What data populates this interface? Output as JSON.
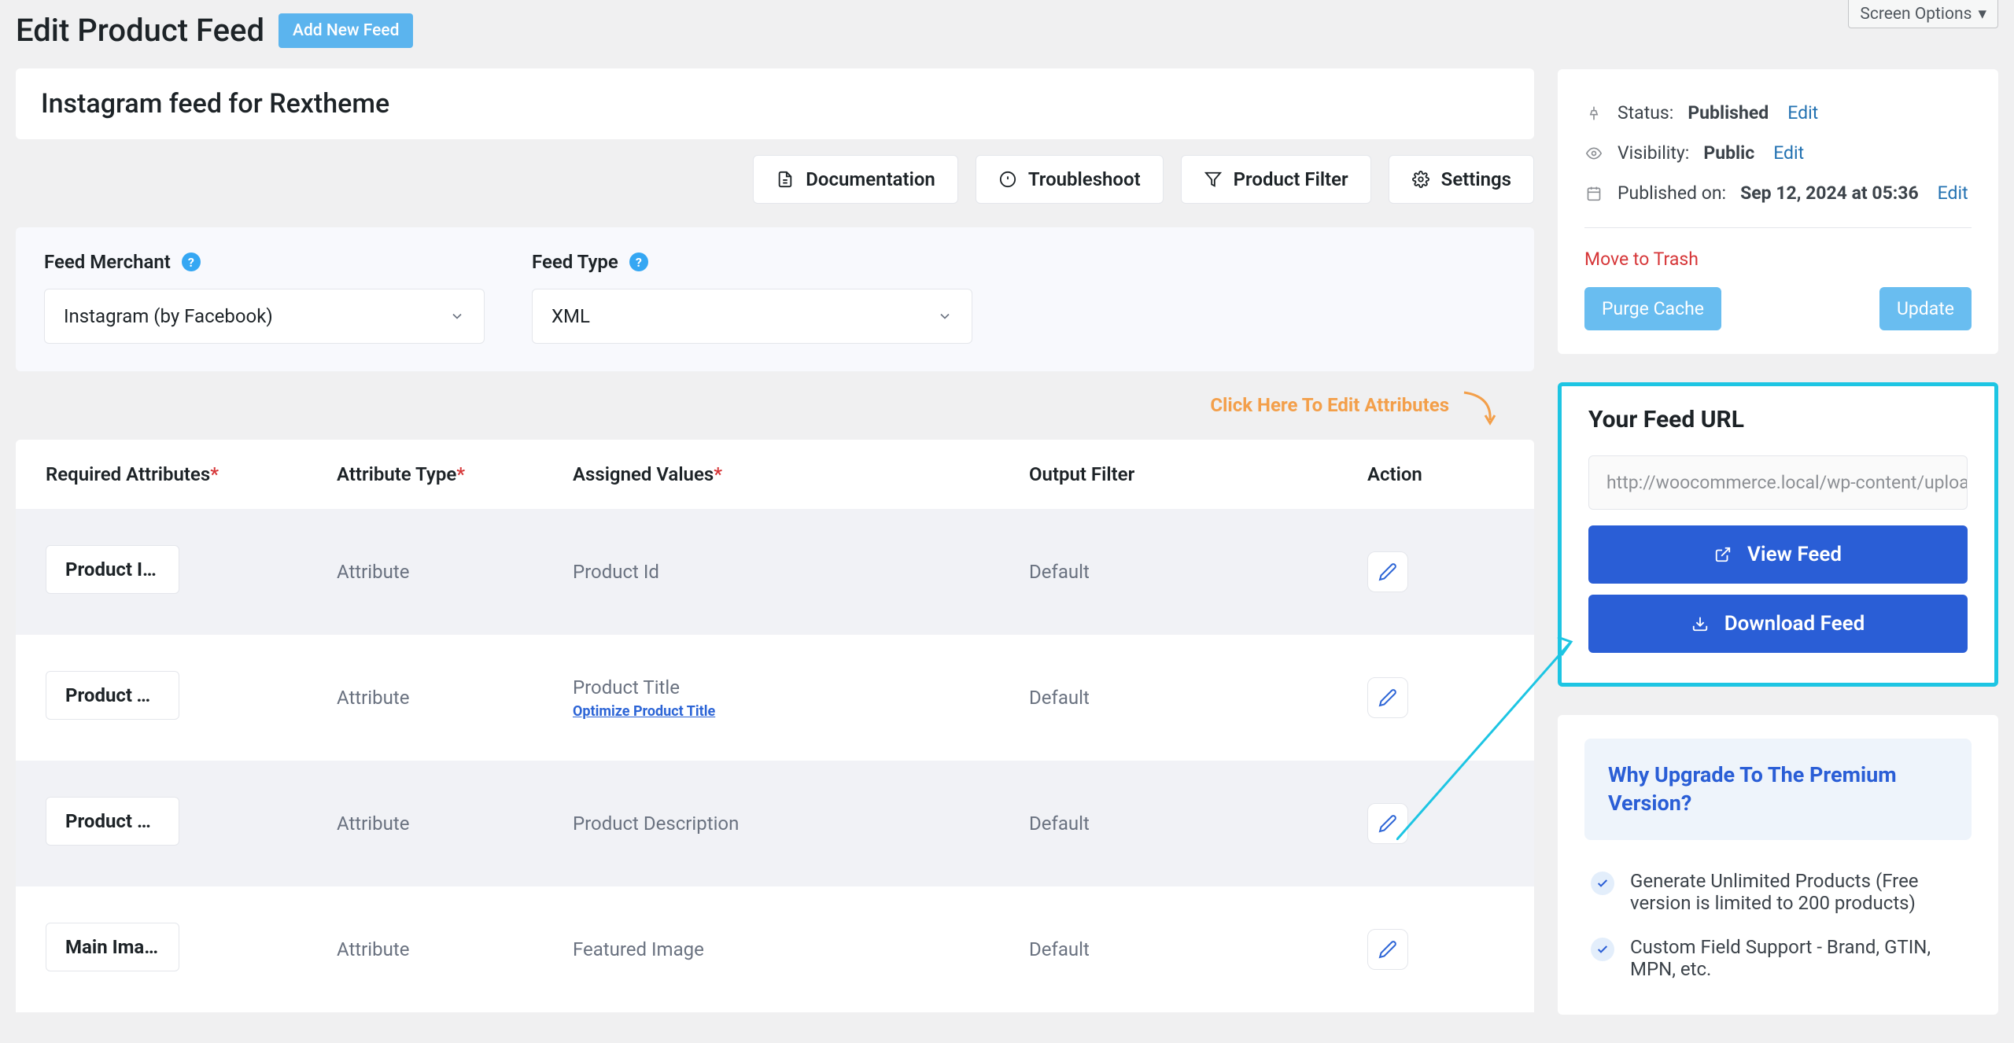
{
  "screen_options_label": "Screen Options",
  "page_title": "Edit Product Feed",
  "add_new_label": "Add New Feed",
  "feed_title": "Instagram feed for Rextheme",
  "toolbar": {
    "documentation": "Documentation",
    "troubleshoot": "Troubleshoot",
    "product_filter": "Product Filter",
    "settings": "Settings"
  },
  "merchant": {
    "label": "Feed Merchant",
    "value": "Instagram (by Facebook)"
  },
  "feed_type": {
    "label": "Feed Type",
    "value": "XML"
  },
  "edit_attributes_hint": "Click Here To Edit Attributes",
  "table_headers": {
    "required": "Required Attributes",
    "type": "Attribute Type",
    "assigned": "Assigned Values",
    "output": "Output Filter",
    "action": "Action"
  },
  "rows": [
    {
      "tag": "Product Id [id]",
      "type": "Attribute",
      "assigned": "Product Id",
      "optimize": "",
      "output": "Default"
    },
    {
      "tag": "Product Title …",
      "type": "Attribute",
      "assigned": "Product Title",
      "optimize": "Optimize Product Title",
      "output": "Default"
    },
    {
      "tag": "Product Desc…",
      "type": "Attribute",
      "assigned": "Product Description",
      "optimize": "",
      "output": "Default"
    },
    {
      "tag": "Main Image […",
      "type": "Attribute",
      "assigned": "Featured Image",
      "optimize": "",
      "output": "Default"
    }
  ],
  "publish_box": {
    "status_label": "Status:",
    "status_value": "Published",
    "visibility_label": "Visibility:",
    "visibility_value": "Public",
    "published_label": "Published on:",
    "published_value": "Sep 12, 2024 at 05:36",
    "edit_link": "Edit",
    "trash": "Move to Trash",
    "purge": "Purge Cache",
    "update": "Update"
  },
  "feed_url_box": {
    "title": "Your Feed URL",
    "url": "http://woocommerce.local/wp-content/uploads",
    "view": "View Feed",
    "download": "Download Feed"
  },
  "upgrade": {
    "title": "Why Upgrade To The Premium Version?",
    "benefits": [
      "Generate Unlimited Products (Free version is limited to 200 products)",
      "Custom Field Support - Brand, GTIN, MPN, etc."
    ]
  }
}
